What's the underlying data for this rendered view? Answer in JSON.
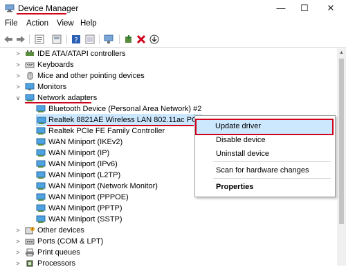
{
  "window": {
    "title": "Device Manager",
    "minimize": "—",
    "maximize": "☐",
    "close": "✕"
  },
  "menu": [
    "File",
    "Action",
    "View",
    "Help"
  ],
  "toolbar": [
    "back-icon",
    "forward-icon",
    "properties-icon",
    "show-hidden-icon",
    "help-icon",
    "view-icon",
    "scan-icon",
    "add-driver-icon",
    "uninstall-icon",
    "download-icon"
  ],
  "tree": {
    "items": [
      {
        "label": "IDE ATA/ATAPI controllers",
        "icon": "ide-controller-icon"
      },
      {
        "label": "Keyboards",
        "icon": "keyboard-icon"
      },
      {
        "label": "Mice and other pointing devices",
        "icon": "mouse-icon"
      },
      {
        "label": "Monitors",
        "icon": "monitor-icon"
      },
      {
        "label": "Network adapters",
        "icon": "network-adapter-icon"
      },
      {
        "label": "Bluetooth Device (Personal Area Network) #2",
        "icon": "network-card-icon"
      },
      {
        "label": "Realtek 8821AE Wireless LAN 802.11ac PCI-E NIC",
        "icon": "network-card-icon"
      },
      {
        "label": "Realtek PCIe FE Family Controller",
        "icon": "network-card-icon"
      },
      {
        "label": "WAN Miniport (IKEv2)",
        "icon": "network-card-icon"
      },
      {
        "label": "WAN Miniport (IP)",
        "icon": "network-card-icon"
      },
      {
        "label": "WAN Miniport (IPv6)",
        "icon": "network-card-icon"
      },
      {
        "label": "WAN Miniport (L2TP)",
        "icon": "network-card-icon"
      },
      {
        "label": "WAN Miniport (Network Monitor)",
        "icon": "network-card-icon"
      },
      {
        "label": "WAN Miniport (PPPOE)",
        "icon": "network-card-icon"
      },
      {
        "label": "WAN Miniport (PPTP)",
        "icon": "network-card-icon"
      },
      {
        "label": "WAN Miniport (SSTP)",
        "icon": "network-card-icon"
      },
      {
        "label": "Other devices",
        "icon": "unknown-device-icon"
      },
      {
        "label": "Ports (COM & LPT)",
        "icon": "port-icon"
      },
      {
        "label": "Print queues",
        "icon": "printer-icon"
      },
      {
        "label": "Processors",
        "icon": "processor-icon"
      }
    ]
  },
  "context_menu": {
    "items": [
      "Update driver",
      "Disable device",
      "Uninstall device",
      "Scan for hardware changes",
      "Properties"
    ]
  },
  "colors": {
    "highlight": "#cce8ff",
    "annotation": "#d0021b"
  }
}
